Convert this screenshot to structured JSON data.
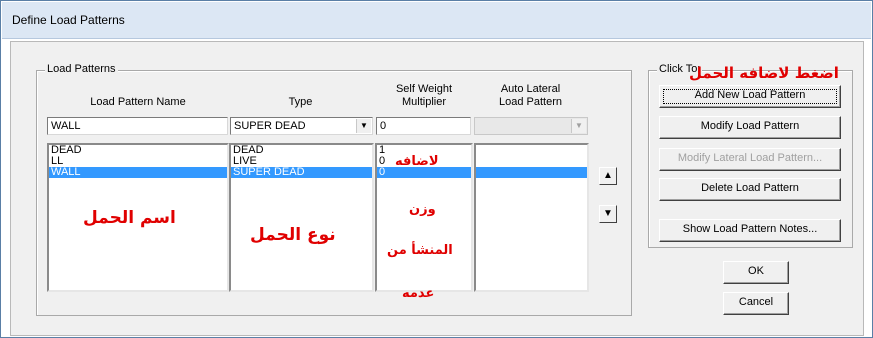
{
  "window": {
    "title": "Define Load Patterns"
  },
  "load_patterns": {
    "group_label": "Load Patterns",
    "headers": {
      "name": "Load Pattern Name",
      "type": "Type",
      "self_weight_1": "Self Weight",
      "self_weight_2": "Multiplier",
      "auto_lateral_1": "Auto Lateral",
      "auto_lateral_2": "Load Pattern"
    },
    "inputs": {
      "name_value": "WALL",
      "type_value": "SUPER DEAD",
      "multiplier_value": "0",
      "auto_lateral_value": ""
    },
    "rows": [
      {
        "name": "DEAD",
        "type": "DEAD",
        "multiplier": "1",
        "auto_lateral": ""
      },
      {
        "name": "LL",
        "type": "LIVE",
        "multiplier": "0",
        "auto_lateral": ""
      },
      {
        "name": "WALL",
        "type": "SUPER DEAD",
        "multiplier": "0",
        "auto_lateral": "",
        "selected": true
      }
    ]
  },
  "click_to": {
    "group_label": "Click To:",
    "add": "Add New Load Pattern",
    "modify": "Modify Load Pattern",
    "modify_lateral": "Modify Lateral Load Pattern...",
    "delete": "Delete Load Pattern",
    "notes": "Show Load Pattern Notes..."
  },
  "buttons": {
    "ok": "OK",
    "cancel": "Cancel"
  },
  "icons": {
    "move_up": "arrow-up-icon",
    "move_down": "arrow-down-icon",
    "dropdown": "chevron-down-icon"
  },
  "annotations": {
    "add_hint": "اضغط لاضافه الحمل",
    "name_hint": "اسم الحمل",
    "type_hint": "نوع الحمل",
    "self_weight_1": "لاضافه",
    "self_weight_2": "وزن",
    "self_weight_3": "المنشأ من",
    "self_weight_4": "عدمه",
    "color": "#e00000"
  }
}
